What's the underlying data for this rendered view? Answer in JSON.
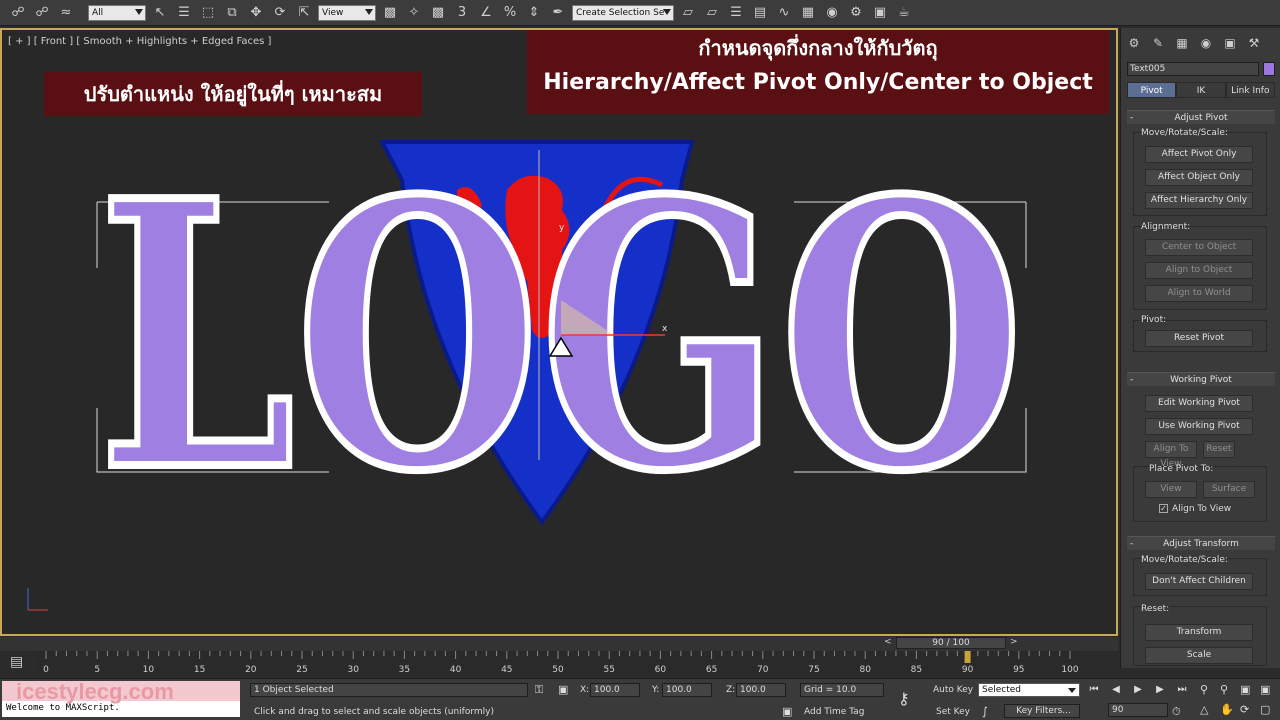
{
  "toolbar": {
    "selection_filter": "All",
    "ref_coord": "View",
    "snap_count": "3",
    "percent_symbol": "%",
    "named_selection": "Create Selection Se"
  },
  "viewport": {
    "label": "[ + ] [ Front ] [ Smooth + Highlights + Edged Faces ]",
    "logo_text": "LOGO",
    "banner_left": "ปรับตำแหน่ง ให้อยู่ในที่ๆ เหมาะสม",
    "banner_right_line1": "กำหนดจุดกึ่งกลางให้กับวัตถุ",
    "banner_right_line2": "Hierarchy/Affect Pivot Only/Center to Object",
    "colors": {
      "shield": "#1530c8",
      "lion": "#e41414",
      "letters": "#9f80e2",
      "banner": "#5a0f12"
    }
  },
  "panel": {
    "object_name": "Text005",
    "object_color": "#9a78e0",
    "tabs": [
      "Pivot",
      "IK",
      "Link Info"
    ],
    "adjust_pivot": {
      "title": "Adjust Pivot",
      "move_label": "Move/Rotate/Scale:",
      "buttons": [
        "Affect Pivot Only",
        "Affect Object Only",
        "Affect Hierarchy Only"
      ],
      "alignment_label": "Alignment:",
      "alignment_buttons": [
        "Center to Object",
        "Align to Object",
        "Align to World"
      ],
      "pivot_label": "Pivot:",
      "reset_pivot": "Reset Pivot"
    },
    "working_pivot": {
      "title": "Working Pivot",
      "edit": "Edit Working Pivot",
      "use": "Use Working Pivot",
      "align_to_view": "Align To View",
      "reset": "Reset",
      "place_label": "Place Pivot To:",
      "view": "View",
      "surface": "Surface",
      "align_check": "Align To View"
    },
    "adjust_transform": {
      "title": "Adjust Transform",
      "move_label": "Move/Rotate/Scale:",
      "dont_affect": "Don't Affect Children",
      "reset_label": "Reset:",
      "transform": "Transform",
      "scale": "Scale"
    }
  },
  "timeline": {
    "frame": "90 / 100",
    "prev": "<",
    "next": ">",
    "ticks": [
      "0",
      "5",
      "10",
      "15",
      "20",
      "25",
      "30",
      "35",
      "40",
      "45",
      "50",
      "55",
      "60",
      "65",
      "70",
      "75",
      "80",
      "85",
      "90",
      "95",
      "100"
    ],
    "current_frame": 90,
    "max_frame": 100
  },
  "status": {
    "watermark": "icestylecg.com",
    "welcome": "Welcome to MAXScript.",
    "selected_count": "1 Object Selected",
    "prompt": "Click and drag to select and scale objects (uniformly)",
    "x_label": "X:",
    "x_value": "100.0",
    "y_label": "Y:",
    "y_value": "100.0",
    "z_label": "Z:",
    "z_value": "100.0",
    "grid": "Grid = 10.0",
    "add_time_tag": "Add Time Tag",
    "auto_key": "Auto Key",
    "set_key": "Set Key",
    "key_mode": "Selected",
    "key_filters": "Key Filters...",
    "frame_field": "90"
  }
}
